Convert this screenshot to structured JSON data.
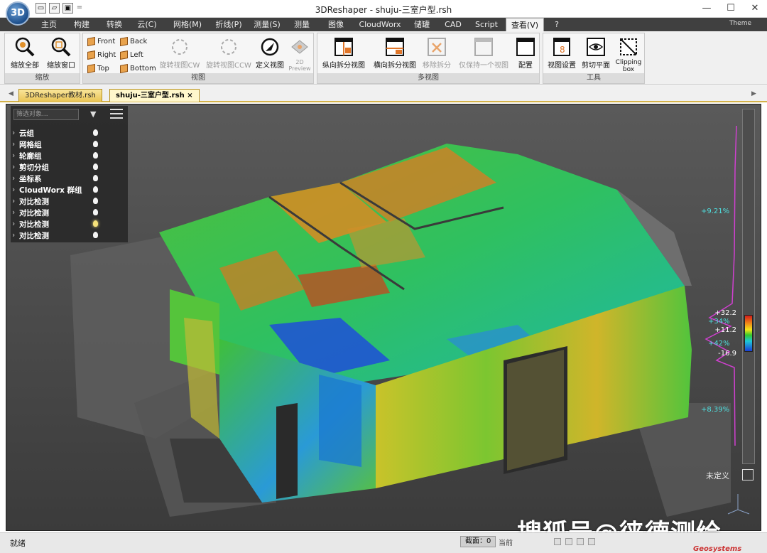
{
  "app": {
    "logo_text": "3D",
    "window_title": "3DReshaper - shuju-三室户型.rsh",
    "window_controls": {
      "minimize": "—",
      "maximize": "☐",
      "close": "✕"
    }
  },
  "quick_access": {
    "icons": [
      "new-file-icon",
      "open-folder-icon",
      "save-icon"
    ],
    "dropdown": "="
  },
  "menu": {
    "items": [
      "主页",
      "构建",
      "转换",
      "云(C)",
      "网格(M)",
      "折线(P)",
      "测量(S)",
      "测量",
      "图像",
      "CloudWorx",
      "储罐",
      "CAD",
      "Script",
      "查看(V)",
      "?"
    ],
    "active": "查看(V)",
    "theme": "Theme"
  },
  "ribbon": {
    "zoom_group": {
      "label": "缩放",
      "zoom_all": "缩放全部",
      "zoom_window": "缩放窗口"
    },
    "view_group": {
      "label": "视图",
      "front": "Front",
      "back": "Back",
      "right": "Right",
      "left": "Left",
      "top": "Top",
      "bottom": "Bottom",
      "rotate_cw": "旋转视图CW",
      "rotate_ccw": "旋转视图CCW",
      "define_view": "定义视图",
      "preview_2d": "2D Preview"
    },
    "multiview_group": {
      "label": "多视图",
      "vertical_split": "纵向拆分视图",
      "horizontal_split": "横向拆分视图",
      "remove_split": "移除拆分",
      "keep_one": "仅保持一个视图",
      "config": "配置"
    },
    "tools_group": {
      "label": "工具",
      "view_settings": "视图设置",
      "clip_plane": "剪切平面",
      "clipping_box": "Clipping box"
    }
  },
  "doc_tabs": [
    {
      "label": "3DReshaper教材.rsh",
      "active": false
    },
    {
      "label": "shuju-三室户型.rsh",
      "active": true
    }
  ],
  "tree": {
    "filter_placeholder": "筛选对象...",
    "items": [
      "云组",
      "网格组",
      "轮廓组",
      "剪切分组",
      "坐标系",
      "CloudWorx 群组",
      "对比检测",
      "对比检测",
      "对比检测",
      "对比检测"
    ]
  },
  "color_scale": {
    "labels": [
      "+32.2",
      "+11.2",
      "-16.9"
    ],
    "percents": [
      "+9.21%",
      "+34%",
      "+42%",
      "+8.39%"
    ],
    "colors": [
      "#d21b1b",
      "#f08a18",
      "#f2e51a",
      "#35c72e",
      "#1fc8d8",
      "#1b3ed6"
    ],
    "undefined_label": "未定义"
  },
  "statusbar": {
    "status": "就绪",
    "section_label": "截面：0",
    "current_label": "当前"
  },
  "watermark": "搜狐号@徕德测绘",
  "brand": "Geosystems"
}
